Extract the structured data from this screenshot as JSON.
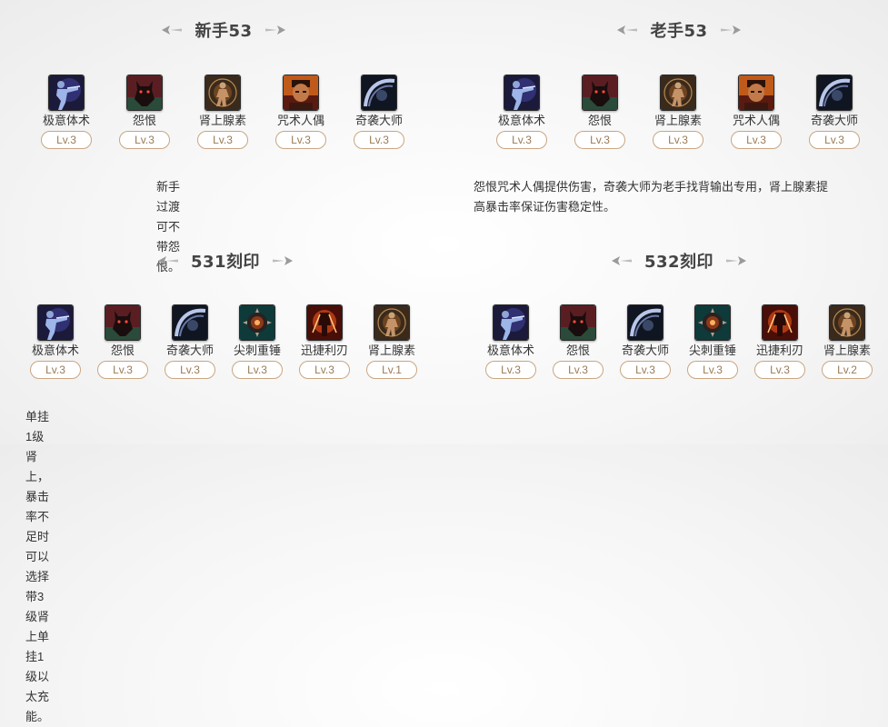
{
  "panels": [
    {
      "title": "新手53",
      "skills": [
        {
          "name": "极意体术",
          "level": "Lv.3",
          "icon": "martial-arts-icon"
        },
        {
          "name": "怨恨",
          "level": "Lv.3",
          "icon": "grudge-icon"
        },
        {
          "name": "肾上腺素",
          "level": "Lv.3",
          "icon": "adrenaline-icon"
        },
        {
          "name": "咒术人偶",
          "level": "Lv.3",
          "icon": "cursed-doll-icon"
        },
        {
          "name": "奇袭大师",
          "level": "Lv.3",
          "icon": "ambush-master-icon"
        }
      ],
      "description": "新手过渡可不带怨恨。"
    },
    {
      "title": "老手53",
      "skills": [
        {
          "name": "极意体术",
          "level": "Lv.3",
          "icon": "martial-arts-icon"
        },
        {
          "name": "怨恨",
          "level": "Lv.3",
          "icon": "grudge-icon"
        },
        {
          "name": "肾上腺素",
          "level": "Lv.3",
          "icon": "adrenaline-icon"
        },
        {
          "name": "咒术人偶",
          "level": "Lv.3",
          "icon": "cursed-doll-icon"
        },
        {
          "name": "奇袭大师",
          "level": "Lv.3",
          "icon": "ambush-master-icon"
        }
      ],
      "description_lines": [
        "怨恨咒术人偶提供伤害，奇袭大师为老手找背输出专用，肾上腺素提",
        "高暴击率保证伤害稳定性。"
      ]
    },
    {
      "title": "531刻印",
      "skills": [
        {
          "name": "极意体术",
          "level": "Lv.3",
          "icon": "martial-arts-icon"
        },
        {
          "name": "怨恨",
          "level": "Lv.3",
          "icon": "grudge-icon"
        },
        {
          "name": "奇袭大师",
          "level": "Lv.3",
          "icon": "ambush-master-icon"
        },
        {
          "name": "尖刺重锤",
          "level": "Lv.3",
          "icon": "spiked-hammer-icon"
        },
        {
          "name": "迅捷利刃",
          "level": "Lv.3",
          "icon": "swift-blade-icon"
        },
        {
          "name": "肾上腺素",
          "level": "Lv.1",
          "icon": "adrenaline-icon"
        }
      ],
      "description": "单挂1级肾上，暴击率不足时可以选择带3级肾上单挂1级以太充能。"
    },
    {
      "title": "532刻印",
      "skills": [
        {
          "name": "极意体术",
          "level": "Lv.3",
          "icon": "martial-arts-icon"
        },
        {
          "name": "怨恨",
          "level": "Lv.3",
          "icon": "grudge-icon"
        },
        {
          "name": "奇袭大师",
          "level": "Lv.3",
          "icon": "ambush-master-icon"
        },
        {
          "name": "尖刺重锤",
          "level": "Lv.3",
          "icon": "spiked-hammer-icon"
        },
        {
          "name": "迅捷利刃",
          "level": "Lv.3",
          "icon": "swift-blade-icon"
        },
        {
          "name": "肾上腺素",
          "level": "Lv.2",
          "icon": "adrenaline-icon"
        }
      ]
    }
  ]
}
